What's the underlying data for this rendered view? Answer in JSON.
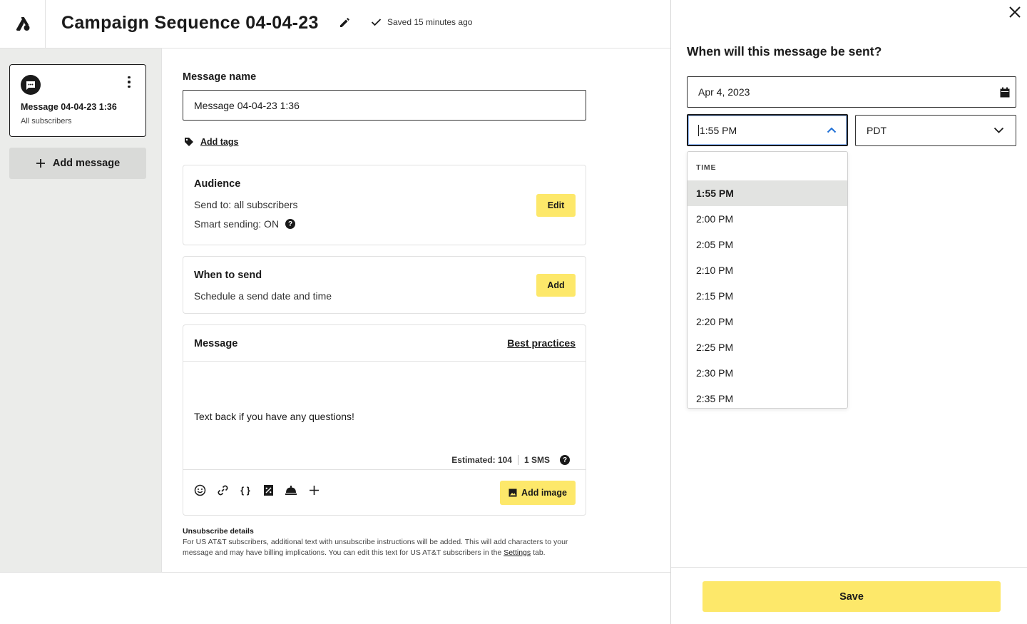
{
  "header": {
    "title": "Campaign Sequence 04-04-23",
    "saved_status": "Saved 15 minutes ago"
  },
  "sidebar": {
    "message_card": {
      "title": "Message 04-04-23 1:36",
      "subtitle": "All subscribers"
    },
    "add_message_label": "Add message"
  },
  "form": {
    "message_name_label": "Message name",
    "message_name_value": "Message 04-04-23 1:36",
    "add_tags_label": "Add tags",
    "audience": {
      "title": "Audience",
      "send_to": "Send to: all subscribers",
      "smart_sending": "Smart sending: ON",
      "button": "Edit"
    },
    "when_to_send": {
      "title": "When to send",
      "description": "Schedule a send date and time",
      "button": "Add"
    },
    "message": {
      "title": "Message",
      "best_practices": "Best practices",
      "body": "Text back if you have any questions!",
      "estimated": "Estimated: 104",
      "sms_count": "1 SMS",
      "add_image": "Add image",
      "toolbar_icons": [
        "emoji-icon",
        "link-icon",
        "variables-icon",
        "discount-icon",
        "concierge-bell-icon",
        "plus-icon"
      ]
    },
    "unsubscribe": {
      "title": "Unsubscribe details",
      "text": "For US AT&T subscribers, additional text with unsubscribe instructions will be added. This will add characters to your message and may have billing implications. You can edit this text for US AT&T subscribers in the",
      "settings_link": "Settings",
      "text_end": "tab."
    }
  },
  "panel": {
    "title": "When will this message be sent?",
    "date_value": "Apr 4, 2023",
    "time_value": "1:55 PM",
    "timezone_value": "PDT",
    "dropdown": {
      "header": "TIME",
      "selected": "1:55 PM",
      "options": [
        "1:55 PM",
        "2:00 PM",
        "2:05 PM",
        "2:10 PM",
        "2:15 PM",
        "2:20 PM",
        "2:25 PM",
        "2:30 PM",
        "2:35 PM"
      ]
    },
    "save_label": "Save"
  },
  "colors": {
    "accent_yellow": "#fde86a",
    "sidebar_bg": "#ebecea",
    "selected_bg": "#e2e3e1",
    "text_dark": "#1a1a1a"
  }
}
